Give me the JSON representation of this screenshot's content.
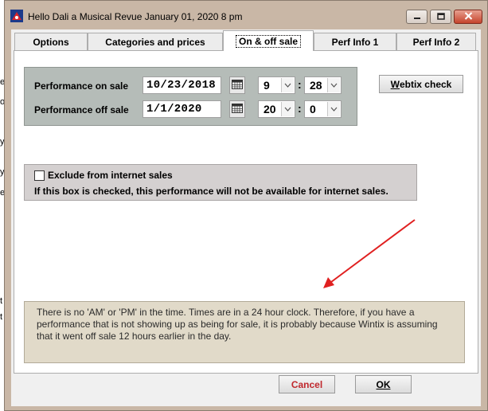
{
  "window": {
    "title": "Hello Dali  a Musical Revue January 01, 2020 8 pm"
  },
  "background_fragments": [
    "e",
    "o",
    "y",
    "y",
    "e",
    "t",
    "t"
  ],
  "tabs": [
    {
      "label": "Options"
    },
    {
      "label": "Categories and prices"
    },
    {
      "label": "On & off sale"
    },
    {
      "label": "Perf Info 1"
    },
    {
      "label": "Perf Info 2"
    }
  ],
  "on_sale": {
    "label": "Performance on sale",
    "date": "10/23/2018",
    "hour": "9",
    "minute": "28"
  },
  "off_sale": {
    "label": "Performance off sale",
    "date": "1/1/2020",
    "hour": "20",
    "minute": "0"
  },
  "time_separator": ":",
  "webtix_button": {
    "label_accel": "W",
    "label_rest": "ebtix check"
  },
  "internet": {
    "checkbox_label": "Exclude from internet sales",
    "checked": false,
    "description": "If this box is checked, this performance will not be available for internet sales."
  },
  "note": {
    "lines": [
      "There is no 'AM' or 'PM' in the time. Times are in a 24 hour clock. Therefore, if you have a",
      "performance that is not showing up as being for sale, it is probably because Wintix is assuming",
      "that it went off sale 12 hours earlier in the day."
    ]
  },
  "buttons": {
    "cancel": "Cancel",
    "ok": "OK"
  },
  "colors": {
    "window_frame": "#c9b7a6",
    "onsale_panel": "#b5bcb8",
    "note_panel": "#e1dac9",
    "cancel_text": "#c0282d",
    "annotation_arrow": "#e02020"
  },
  "icons": [
    "app-icon",
    "minimize-icon",
    "maximize-icon",
    "close-icon",
    "calendar-icon",
    "chevron-down-icon"
  ]
}
